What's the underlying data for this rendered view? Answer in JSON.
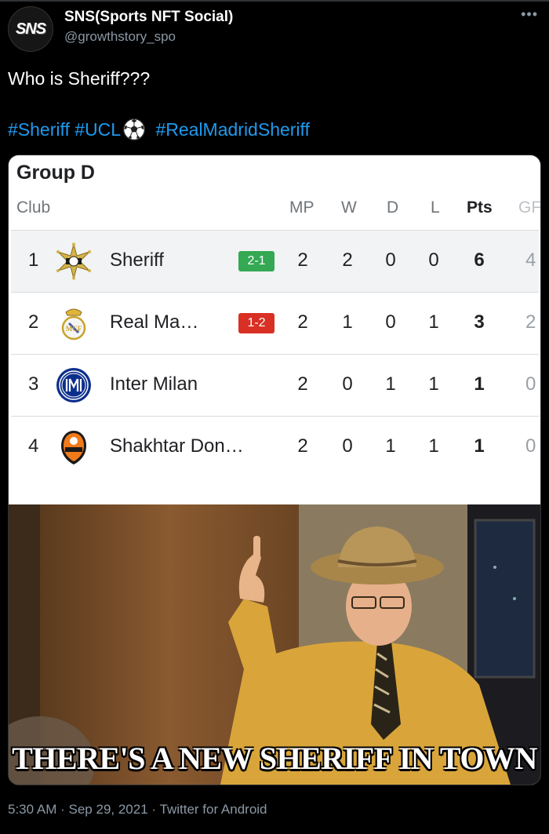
{
  "tweet": {
    "author_name": "SNS(Sports NFT Social)",
    "author_handle": "@growthstory_spo",
    "avatar_text": "SNS",
    "more_icon": "more-horizontal-icon",
    "text": "Who is Sheriff???",
    "hashtags": [
      "#Sheriff",
      "#UCL",
      "#RealMadridSheriff"
    ],
    "timestamp": "5:30 AM",
    "date": "Sep 29, 2021",
    "source": "Twitter for Android",
    "separator": "·"
  },
  "standings": {
    "title": "Group D",
    "columns": {
      "club": "Club",
      "mp": "MP",
      "w": "W",
      "d": "D",
      "l": "L",
      "pts": "Pts",
      "gf": "GF"
    },
    "rows": [
      {
        "pos": "1",
        "club": "Sheriff",
        "result": "2-1",
        "result_type": "win",
        "mp": "2",
        "w": "2",
        "d": "0",
        "l": "0",
        "pts": "6",
        "gf": "4",
        "crest": "sheriff-crest-icon"
      },
      {
        "pos": "2",
        "club": "Real Ma…",
        "result": "1-2",
        "result_type": "loss",
        "mp": "2",
        "w": "1",
        "d": "0",
        "l": "1",
        "pts": "3",
        "gf": "2",
        "crest": "real-madrid-crest-icon"
      },
      {
        "pos": "3",
        "club": "Inter Milan",
        "result": "",
        "result_type": "",
        "mp": "2",
        "w": "0",
        "d": "1",
        "l": "1",
        "pts": "1",
        "gf": "0",
        "crest": "inter-milan-crest-icon"
      },
      {
        "pos": "4",
        "club": "Shakhtar Don…",
        "result": "",
        "result_type": "",
        "mp": "2",
        "w": "0",
        "d": "1",
        "l": "1",
        "pts": "1",
        "gf": "0",
        "crest": "shakhtar-crest-icon"
      }
    ]
  },
  "meme": {
    "caption": "THERE'S A NEW SHERIFF IN TOWN"
  },
  "colors": {
    "hashtag": "#1d9bf0",
    "win": "#34a853",
    "loss": "#d93025"
  }
}
